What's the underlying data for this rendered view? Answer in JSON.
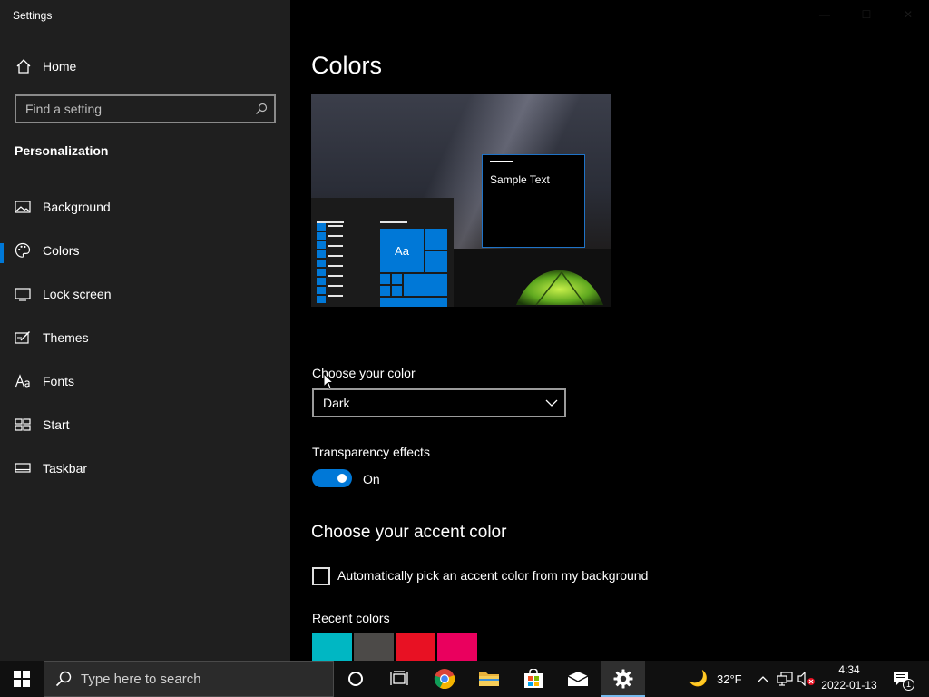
{
  "window": {
    "title": "Settings",
    "minimize_glyph": "—",
    "maximize_glyph": "☐",
    "close_glyph": "✕"
  },
  "sidebar": {
    "home_label": "Home",
    "search_placeholder": "Find a setting",
    "section_title": "Personalization",
    "items": [
      {
        "label": "Background",
        "icon": "picture-icon"
      },
      {
        "label": "Colors",
        "icon": "palette-icon",
        "active": true
      },
      {
        "label": "Lock screen",
        "icon": "lock-screen-icon"
      },
      {
        "label": "Themes",
        "icon": "themes-icon"
      },
      {
        "label": "Fonts",
        "icon": "fonts-icon"
      },
      {
        "label": "Start",
        "icon": "start-icon"
      },
      {
        "label": "Taskbar",
        "icon": "taskbar-icon"
      }
    ]
  },
  "main": {
    "title": "Colors",
    "preview": {
      "sample_text": "Sample Text",
      "tile_text": "Aa"
    },
    "choose_color_label": "Choose your color",
    "choose_color_value": "Dark",
    "transparency_label": "Transparency effects",
    "transparency_state": "On",
    "accent_heading": "Choose your accent color",
    "auto_accent_label": "Automatically pick an accent color from my background",
    "recent_colors_label": "Recent colors",
    "recent_colors": [
      "#00b7c3",
      "#4c4a48",
      "#e81123",
      "#ea005e"
    ]
  },
  "colors": {
    "accent": "#0078d7",
    "sidebar_bg": "#1f1f1f",
    "main_bg": "#000000"
  },
  "taskbar": {
    "search_placeholder": "Type here to search",
    "temperature": "32°F",
    "time": "4:34",
    "date": "2022-01-13",
    "notification_count": "1"
  }
}
